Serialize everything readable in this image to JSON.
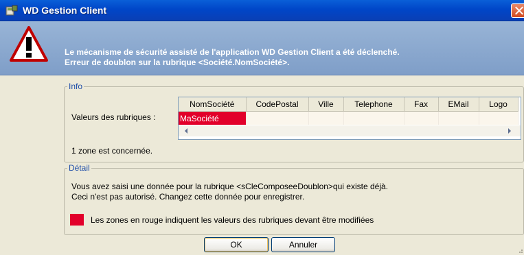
{
  "window": {
    "title": "WD Gestion Client"
  },
  "banner": {
    "line1": "Le mécanisme de sécurité assisté de l'application WD Gestion Client a été déclenché.",
    "line2": "Erreur de doublon sur la rubrique <Société.NomSociété>."
  },
  "info": {
    "legend": "Info",
    "values_label": "Valeurs des rubriques :",
    "columns": [
      "NomSociété",
      "CodePostal",
      "Ville",
      "Telephone",
      "Fax",
      "EMail",
      "Logo"
    ],
    "row": [
      "MaSociété",
      "",
      "",
      "",
      "",
      "",
      ""
    ],
    "zone_count_text": "1 zone est concernée."
  },
  "detail": {
    "legend": "Détail",
    "line1": "Vous avez saisi une donnée pour la rubrique <sCleComposeeDoublon>qui existe déjà.",
    "line2": "Ceci n'est pas autorisé. Changez cette donnée pour enregistrer.",
    "legend_note": "Les zones en rouge indiquent les valeurs des rubriques devant être modifiées"
  },
  "buttons": {
    "ok": "OK",
    "cancel": "Annuler"
  },
  "colors": {
    "titlebar": "#0046c8",
    "banner": "#8aa8d0",
    "error_red": "#e2002a",
    "group_label": "#1f4ea8"
  }
}
